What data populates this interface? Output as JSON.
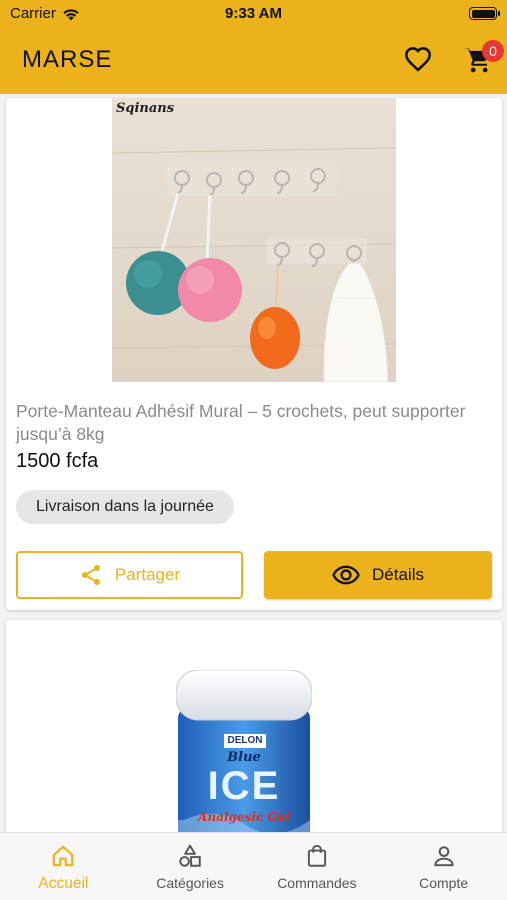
{
  "status_bar": {
    "carrier": "Carrier",
    "time": "9:33 AM"
  },
  "app_bar": {
    "title": "MARSE",
    "cart_count": "0"
  },
  "products": [
    {
      "image_text": "Sqinans",
      "name": "Porte-Manteau Adhésif Mural – 5 crochets, peut supporter jusqu’à 8kg",
      "price": "1500 fcfa",
      "delivery_chip": "Livraison dans la journée",
      "share_label": "Partager",
      "details_label": "Détails"
    },
    {
      "image_text": {
        "brand": "DELON",
        "line": "Blue",
        "product": "ICE",
        "subtitle": "Analgesic Gel"
      }
    }
  ],
  "tab_bar": {
    "items": [
      {
        "label": "Accueil",
        "icon": "home-icon",
        "active": true
      },
      {
        "label": "Catégories",
        "icon": "categories-icon",
        "active": false
      },
      {
        "label": "Commandes",
        "icon": "shopping-bag-icon",
        "active": false
      },
      {
        "label": "Compte",
        "icon": "person-icon",
        "active": false
      }
    ]
  },
  "colors": {
    "accent": "#ecb21c",
    "badge": "#e53935",
    "name_text": "#8a8a8a"
  }
}
